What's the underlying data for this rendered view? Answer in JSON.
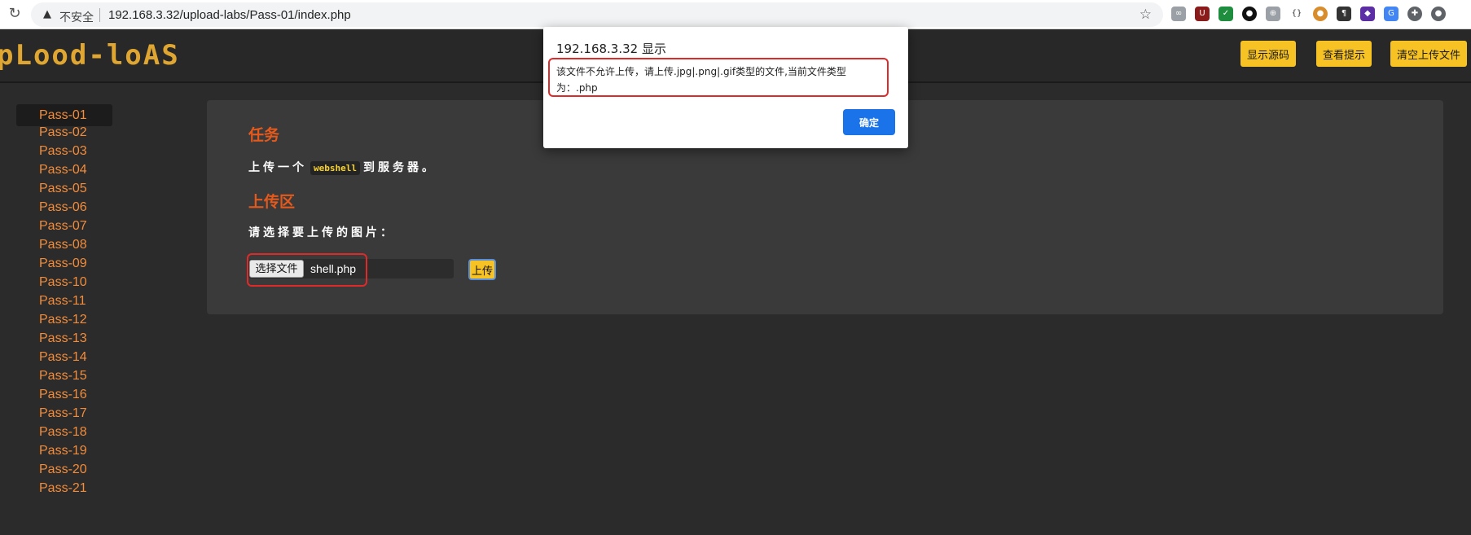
{
  "browser": {
    "insecure_label": "不安全",
    "url": "192.168.3.32/upload-labs/Pass-01/index.php",
    "extension_icons": [
      "extension-icon-1",
      "ublock-icon",
      "extension-icon-3",
      "extension-icon-4",
      "extension-icon-5",
      "json-viewer-icon",
      "cookie-icon",
      "pilcrow-icon",
      "extension-icon-9",
      "translate-icon",
      "puzzle-icon",
      "profile-icon"
    ]
  },
  "header": {
    "logo": "pLood-loAS",
    "buttons": {
      "show_source": "显示源码",
      "view_hint": "查看提示",
      "clear_uploads": "清空上传文件"
    }
  },
  "sidebar": {
    "items": [
      "Pass-01",
      "Pass-02",
      "Pass-03",
      "Pass-04",
      "Pass-05",
      "Pass-06",
      "Pass-07",
      "Pass-08",
      "Pass-09",
      "Pass-10",
      "Pass-11",
      "Pass-12",
      "Pass-13",
      "Pass-14",
      "Pass-15",
      "Pass-16",
      "Pass-17",
      "Pass-18",
      "Pass-19",
      "Pass-20",
      "Pass-21"
    ],
    "active": "Pass-01"
  },
  "main": {
    "task_title": "任务",
    "task_prefix": "上传一个",
    "task_code": "webshell",
    "task_suffix": "到服务器。",
    "upload_title": "上传区",
    "choose_label": "请选择要上传的图片：",
    "choose_button": "选择文件",
    "file_name": "shell.php",
    "upload_button": "上传"
  },
  "dialog": {
    "title": "192.168.3.32 显示",
    "message": "该文件不允许上传，请上传.jpg|.png|.gif类型的文件,当前文件类型为：.php",
    "ok_button": "确定"
  },
  "colors": {
    "accent_yellow": "#f6c224",
    "sidebar_link": "#f48c3a",
    "section_title": "#e55a1c",
    "highlight_red": "#e02a2a",
    "dialog_button": "#1a73e8"
  }
}
